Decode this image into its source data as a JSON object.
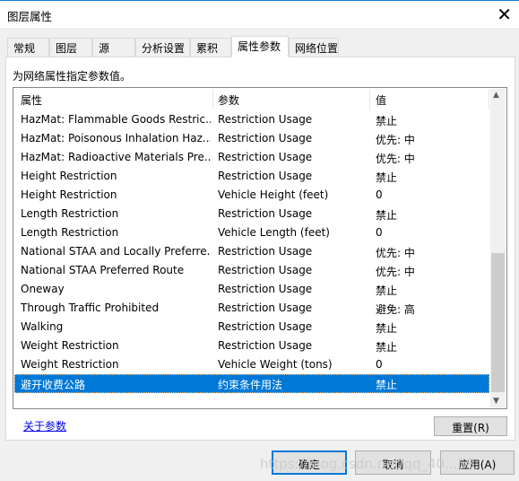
{
  "window": {
    "title": "图层属性",
    "close_icon": "close-icon"
  },
  "tabs": [
    {
      "label": "常规"
    },
    {
      "label": "图层"
    },
    {
      "label": "源"
    },
    {
      "label": "分析设置"
    },
    {
      "label": "累积"
    },
    {
      "label": "属性参数",
      "selected": true
    },
    {
      "label": "网络位置"
    }
  ],
  "panel": {
    "hint": "为网络属性指定参数值。"
  },
  "table": {
    "columns": [
      "属性",
      "参数",
      "值"
    ],
    "rows": [
      [
        "HazMat: Flammable Goods Restric...",
        "Restriction Usage",
        "禁止"
      ],
      [
        "HazMat: Poisonous Inhalation Haz...",
        "Restriction Usage",
        "优先: 中"
      ],
      [
        "HazMat: Radioactive Materials Pre...",
        "Restriction Usage",
        "优先: 中"
      ],
      [
        "Height Restriction",
        "Restriction Usage",
        "禁止"
      ],
      [
        "Height Restriction",
        "Vehicle Height (feet)",
        "0"
      ],
      [
        "Length Restriction",
        "Restriction Usage",
        "禁止"
      ],
      [
        "Length Restriction",
        "Vehicle Length (feet)",
        "0"
      ],
      [
        "National STAA and Locally Preferre...",
        "Restriction Usage",
        "优先: 中"
      ],
      [
        "National STAA Preferred Route",
        "Restriction Usage",
        "优先: 中"
      ],
      [
        "Oneway",
        "Restriction Usage",
        "禁止"
      ],
      [
        "Through Traffic Prohibited",
        "Restriction Usage",
        "避免: 高"
      ],
      [
        "Walking",
        "Restriction Usage",
        "禁止"
      ],
      [
        "Weight Restriction",
        "Restriction Usage",
        "禁止"
      ],
      [
        "Weight Restriction",
        "Vehicle Weight (tons)",
        "0"
      ],
      [
        "避开收费公路",
        "约束条件用法",
        "禁止"
      ]
    ],
    "selected_row": 14
  },
  "about_link": "关于参数",
  "reset_button": "重置(R)",
  "buttons": {
    "ok": "确定",
    "cancel": "取消",
    "apply": "应用(A)"
  },
  "watermark": "https://blog.csdn.net/qq_40...58",
  "colors": {
    "selection": "#0078d7",
    "accent": "#0078d7"
  }
}
